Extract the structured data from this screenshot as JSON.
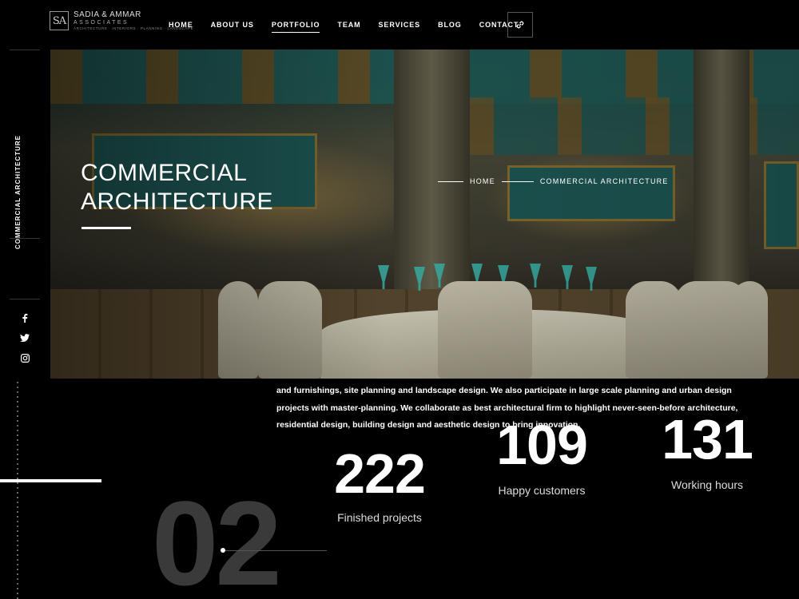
{
  "logo": {
    "mark": "SA",
    "name": "SADIA & AMMAR",
    "subname": "ASSOCIATES",
    "tagline": "ARCHITECTURE · INTERIORS · PLANNING · LANDSCAPE"
  },
  "nav": {
    "items": [
      {
        "label": "HOME"
      },
      {
        "label": "ABOUT US"
      },
      {
        "label": "PORTFOLIO",
        "active": true
      },
      {
        "label": "TEAM"
      },
      {
        "label": "SERVICES"
      },
      {
        "label": "BLOG"
      },
      {
        "label": "CONTACT"
      }
    ],
    "icon_button": "link-icon"
  },
  "sidebar": {
    "title": "COMMERCIAL ARCHITECTURE",
    "social": [
      "facebook-icon",
      "twitter-icon",
      "instagram-icon"
    ]
  },
  "hero": {
    "title": "COMMERCIAL\nARCHITECTURE",
    "breadcrumb": {
      "home": "HOME",
      "current": "COMMERCIAL ARCHITECTURE"
    }
  },
  "about": {
    "text_1": "and furnishings, site planning and landscape design. We also participate in large scale planning and urban design projects with master-planning. We collaborate as ",
    "highlight": "best architectural firm",
    "text_2": " to highlight never-seen-before architecture, residential design, building design and aesthetic design to bring innovation."
  },
  "stats": [
    {
      "value": "222",
      "label": "Finished projects"
    },
    {
      "value": "109",
      "label": "Happy customers"
    },
    {
      "value": "131",
      "label": "Working hours"
    }
  ],
  "section_number": "02",
  "colors": {
    "background": "#000000",
    "text": "#ffffff",
    "muted_number": "#3a3a3a"
  }
}
